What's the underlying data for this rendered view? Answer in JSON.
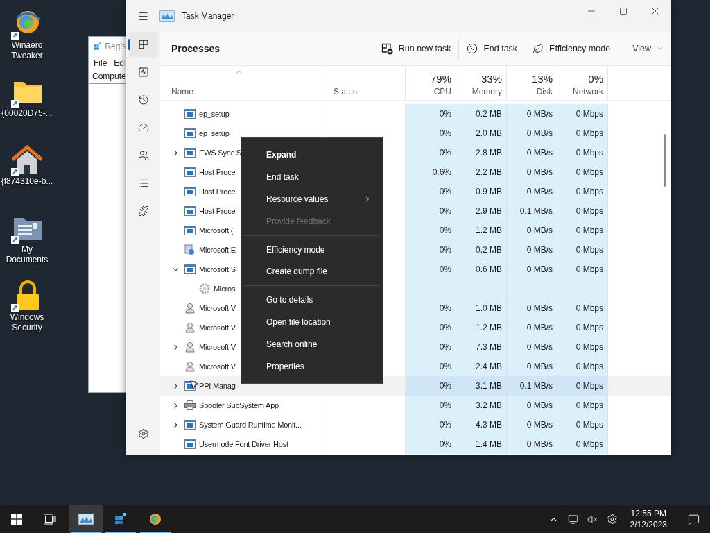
{
  "desktop_icons": [
    {
      "label": "Winaero Tweaker"
    },
    {
      "label": "{00020D75-..."
    },
    {
      "label": "{f874310e-b..."
    },
    {
      "label": "My Documents"
    },
    {
      "label": "Windows Security"
    }
  ],
  "registry_window": {
    "title": "Regis",
    "menu": [
      "File",
      "Edi"
    ],
    "address": "Compute"
  },
  "task_manager": {
    "title": "Task Manager",
    "nav": [
      {
        "selected": true
      },
      {
        "selected": false
      },
      {
        "selected": false
      },
      {
        "selected": false
      },
      {
        "selected": false
      },
      {
        "selected": false
      },
      {
        "selected": false
      }
    ],
    "page_title": "Processes",
    "toolbar": [
      {
        "kind": "button",
        "label": "Run new task"
      },
      {
        "kind": "button",
        "label": "End task"
      },
      {
        "kind": "button",
        "label": "Efficiency mode"
      },
      {
        "kind": "dropdown",
        "label": "View"
      }
    ],
    "columns": [
      {
        "label": "Name",
        "sorted": true
      },
      {
        "label": "Status",
        "sorted": false
      },
      {
        "label": "CPU",
        "total": "79%",
        "sorted": false
      },
      {
        "label": "Memory",
        "total": "33%",
        "sorted": false
      },
      {
        "label": "Disk",
        "total": "13%",
        "sorted": false
      },
      {
        "label": "Network",
        "total": "0%",
        "sorted": false
      }
    ],
    "rows": [
      {
        "name": "ep_setup",
        "kind": "app",
        "expandable": false,
        "expanded": false,
        "hovered": false,
        "cpu": "0%",
        "memory": "0.2 MB",
        "disk": "0 MB/s",
        "network": "0 Mbps"
      },
      {
        "name": "ep_setup",
        "kind": "app",
        "expandable": false,
        "expanded": false,
        "hovered": false,
        "cpu": "0%",
        "memory": "2.0 MB",
        "disk": "0 MB/s",
        "network": "0 Mbps"
      },
      {
        "name": "EWS Sync S",
        "kind": "app",
        "expandable": true,
        "expanded": false,
        "hovered": false,
        "cpu": "0%",
        "memory": "2.8 MB",
        "disk": "0 MB/s",
        "network": "0 Mbps"
      },
      {
        "name": "Host Proce",
        "kind": "app",
        "expandable": false,
        "expanded": false,
        "hovered": false,
        "cpu": "0.6%",
        "memory": "2.2 MB",
        "disk": "0 MB/s",
        "network": "0 Mbps"
      },
      {
        "name": "Host Proce",
        "kind": "app",
        "expandable": false,
        "expanded": false,
        "hovered": false,
        "cpu": "0%",
        "memory": "0.9 MB",
        "disk": "0 MB/s",
        "network": "0 Mbps"
      },
      {
        "name": "Host Proce",
        "kind": "app",
        "expandable": false,
        "expanded": false,
        "hovered": false,
        "cpu": "0%",
        "memory": "2.9 MB",
        "disk": "0.1 MB/s",
        "network": "0 Mbps"
      },
      {
        "name": "Microsoft (",
        "kind": "app",
        "expandable": false,
        "expanded": false,
        "hovered": false,
        "cpu": "0%",
        "memory": "1.2 MB",
        "disk": "0 MB/s",
        "network": "0 Mbps"
      },
      {
        "name": "Microsoft E",
        "kind": "installer",
        "expandable": false,
        "expanded": false,
        "hovered": false,
        "cpu": "0%",
        "memory": "0.2 MB",
        "disk": "0 MB/s",
        "network": "0 Mbps"
      },
      {
        "name": "Microsoft S",
        "kind": "app",
        "expandable": true,
        "expanded": true,
        "hovered": false,
        "cpu": "0%",
        "memory": "0.6 MB",
        "disk": "0 MB/s",
        "network": "0 Mbps",
        "children": [
          {
            "name": "Micros",
            "kind": "service"
          }
        ]
      },
      {
        "name": "Microsoft V",
        "kind": "user",
        "expandable": false,
        "expanded": false,
        "hovered": false,
        "cpu": "0%",
        "memory": "1.0 MB",
        "disk": "0 MB/s",
        "network": "0 Mbps"
      },
      {
        "name": "Microsoft V",
        "kind": "user",
        "expandable": false,
        "expanded": false,
        "hovered": false,
        "cpu": "0%",
        "memory": "1.2 MB",
        "disk": "0 MB/s",
        "network": "0 Mbps"
      },
      {
        "name": "Microsoft V",
        "kind": "user",
        "expandable": true,
        "expanded": false,
        "hovered": false,
        "cpu": "0%",
        "memory": "7.3 MB",
        "disk": "0 MB/s",
        "network": "0 Mbps"
      },
      {
        "name": "Microsoft V",
        "kind": "user",
        "expandable": false,
        "expanded": false,
        "hovered": false,
        "cpu": "0%",
        "memory": "2.4 MB",
        "disk": "0 MB/s",
        "network": "0 Mbps"
      },
      {
        "name": "PPI Manag",
        "kind": "app",
        "expandable": true,
        "expanded": false,
        "hovered": true,
        "cpu": "0%",
        "memory": "3.1 MB",
        "disk": "0.1 MB/s",
        "network": "0 Mbps"
      },
      {
        "name": "Spooler SubSystem App",
        "kind": "printer",
        "expandable": true,
        "expanded": false,
        "hovered": false,
        "cpu": "0%",
        "memory": "3.2 MB",
        "disk": "0 MB/s",
        "network": "0 Mbps"
      },
      {
        "name": "System Guard Runtime Monit...",
        "kind": "app",
        "expandable": true,
        "expanded": false,
        "hovered": false,
        "cpu": "0%",
        "memory": "4.3 MB",
        "disk": "0 MB/s",
        "network": "0 Mbps"
      },
      {
        "name": "Usermode Font Driver Host",
        "kind": "app",
        "expandable": false,
        "expanded": false,
        "hovered": false,
        "cpu": "0%",
        "memory": "1.4 MB",
        "disk": "0 MB/s",
        "network": "0 Mbps"
      }
    ]
  },
  "context_menu": [
    {
      "kind": "item",
      "label": "Expand",
      "default": true,
      "disabled": false,
      "submenu": false
    },
    {
      "kind": "item",
      "label": "End task",
      "default": false,
      "disabled": false,
      "submenu": false
    },
    {
      "kind": "item",
      "label": "Resource values",
      "default": false,
      "disabled": false,
      "submenu": true
    },
    {
      "kind": "item",
      "label": "Provide feedback",
      "default": false,
      "disabled": true,
      "submenu": false
    },
    {
      "kind": "separator"
    },
    {
      "kind": "item",
      "label": "Efficiency mode",
      "default": false,
      "disabled": false,
      "submenu": false
    },
    {
      "kind": "item",
      "label": "Create dump file",
      "default": false,
      "disabled": false,
      "submenu": false
    },
    {
      "kind": "separator"
    },
    {
      "kind": "item",
      "label": "Go to details",
      "default": false,
      "disabled": false,
      "submenu": false
    },
    {
      "kind": "item",
      "label": "Open file location",
      "default": false,
      "disabled": false,
      "submenu": false
    },
    {
      "kind": "item",
      "label": "Search online",
      "default": false,
      "disabled": false,
      "submenu": false
    },
    {
      "kind": "item",
      "label": "Properties",
      "default": false,
      "disabled": false,
      "submenu": false
    }
  ],
  "taskbar": {
    "apps": [
      {
        "running": true,
        "active": true
      },
      {
        "running": true,
        "active": false
      },
      {
        "running": true,
        "active": false
      }
    ],
    "time": "12:55 PM",
    "date": "2/12/2023"
  }
}
